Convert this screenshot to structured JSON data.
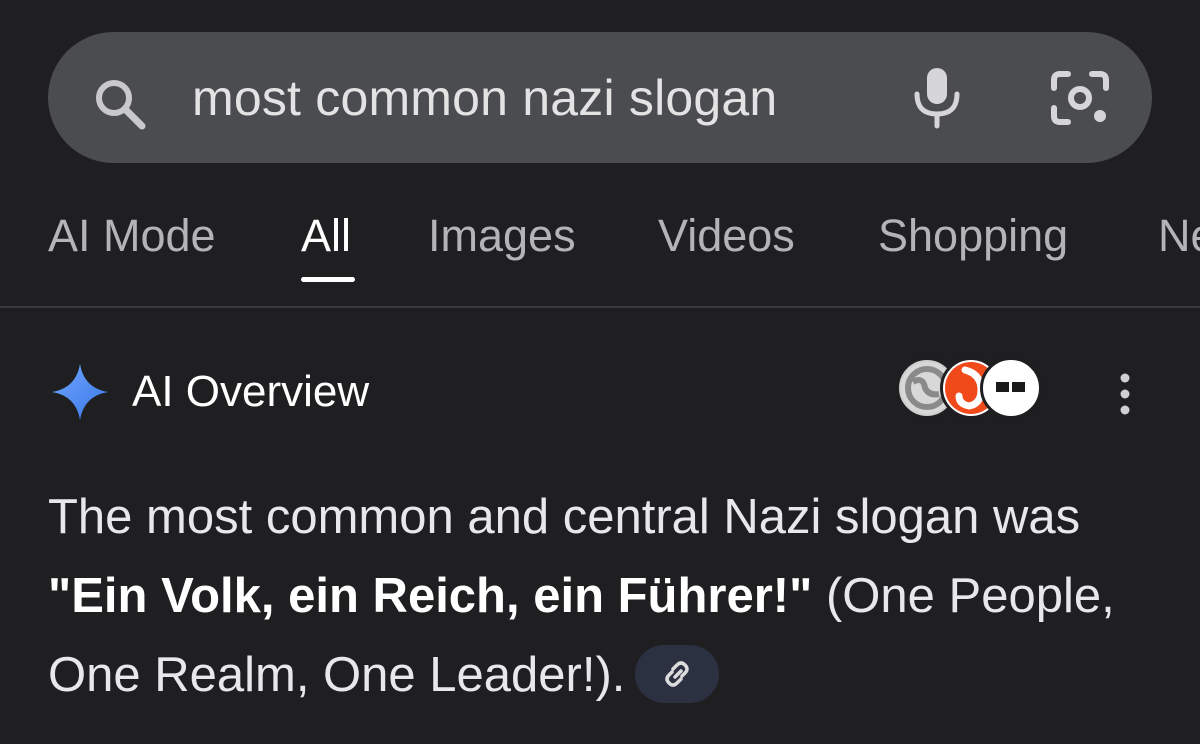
{
  "search": {
    "query": "most common nazi slogan"
  },
  "tabs": [
    {
      "label": "AI Mode"
    },
    {
      "label": "All",
      "active": true
    },
    {
      "label": "Images"
    },
    {
      "label": "Videos"
    },
    {
      "label": "Shopping"
    },
    {
      "label": "Ne"
    }
  ],
  "overview": {
    "title": "AI Overview",
    "sources_icons": [
      "globe-source-icon",
      "red-flame-source-icon",
      "dark-blocks-source-icon"
    ],
    "answer": {
      "part1": "The most common and central Nazi slogan was ",
      "bold": "\"Ein Volk, ein Reich, ein Führer!\"",
      "part2": " (One People, One Realm, One Leader!)."
    }
  },
  "colors": {
    "background": "#1f1f21",
    "search_bg": "#4a4c50",
    "sparkle": "#4f8cf2",
    "chip_bg": "#2c3142"
  }
}
